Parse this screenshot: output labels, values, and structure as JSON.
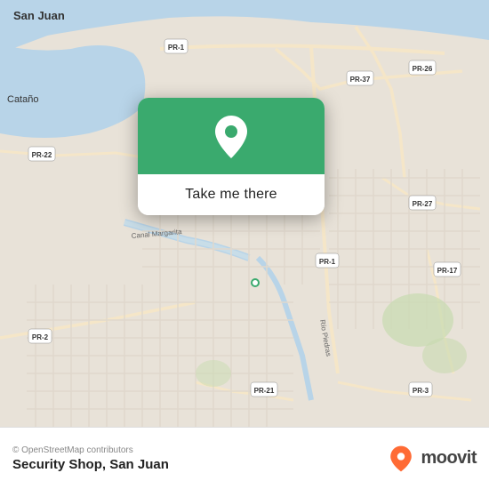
{
  "map": {
    "alt": "Map of San Juan, Puerto Rico"
  },
  "card": {
    "button_label": "Take me there"
  },
  "bottom_bar": {
    "osm_credit": "© OpenStreetMap contributors",
    "location_name": "Security Shop, San Juan",
    "moovit_label": "moovit"
  },
  "colors": {
    "green": "#3aaa6e",
    "moovit_orange": "#FF6B35"
  }
}
